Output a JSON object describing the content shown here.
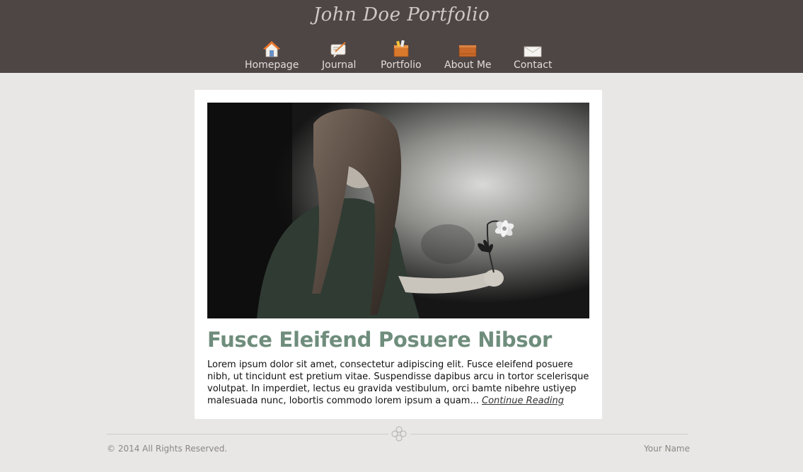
{
  "header": {
    "site_title": "John Doe Portfolio"
  },
  "nav": {
    "items": [
      {
        "label": "Homepage",
        "icon": "home-icon"
      },
      {
        "label": "Journal",
        "icon": "journal-icon"
      },
      {
        "label": "Portfolio",
        "icon": "portfolio-icon"
      },
      {
        "label": "About Me",
        "icon": "about-me-icon"
      },
      {
        "label": "Contact",
        "icon": "envelope-icon"
      }
    ]
  },
  "post": {
    "image_icon": "featured-photo",
    "title": "Fusce Eleifend Posuere Nibsor",
    "body": "Lorem ipsum dolor sit amet, consectetur adipiscing elit. Fusce eleifend posuere nibh, ut tincidunt est pretium vitae. Suspendisse dapibus arcu in tortor scelerisque volutpat. In imperdiet, lectus eu gravida vestibulum, orci bamte nibehre ustiyep malesuada nunc, lobortis commodo lorem ipsum a quam... ",
    "read_more": "Continue Reading"
  },
  "footer": {
    "copyright": "© 2014 All Rights Reserved.",
    "author": "Your Name"
  },
  "colors": {
    "header_bg": "#4e4545",
    "page_bg": "#e8e7e6",
    "title_green": "#6f8d7c",
    "nav_text": "#e2dcd8"
  }
}
